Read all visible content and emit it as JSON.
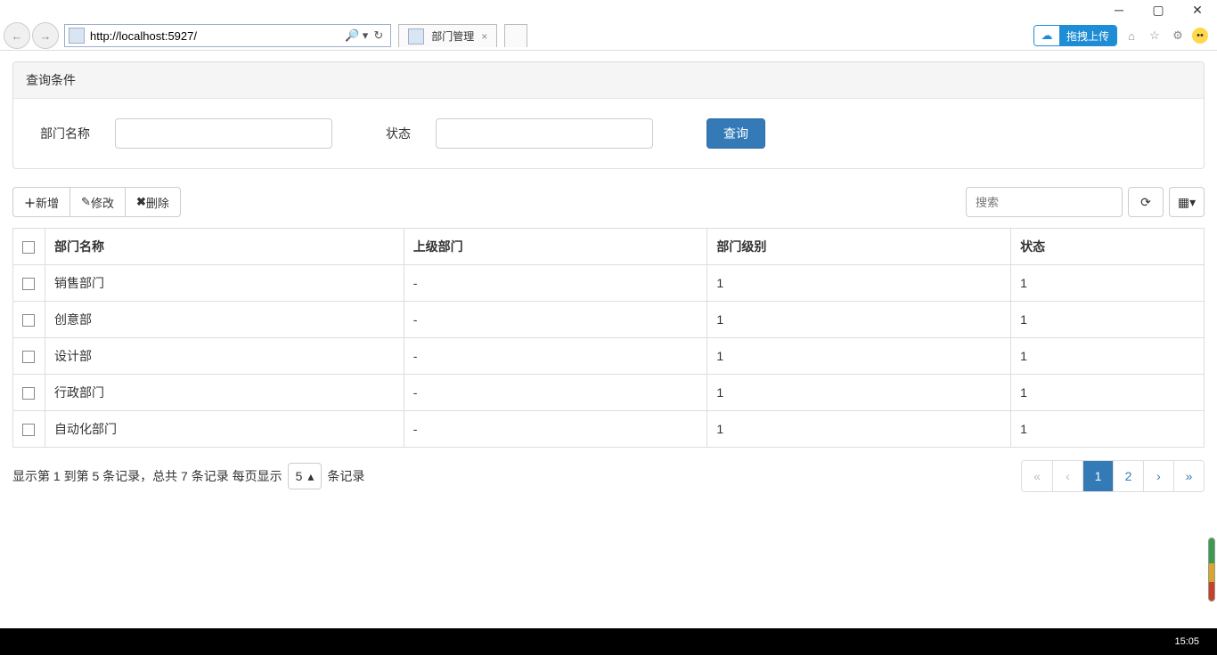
{
  "window": {
    "url": "http://localhost:5927/",
    "tab_title": "部门管理"
  },
  "chrome": {
    "drag_upload": "拖拽上传",
    "taskbar_time": "15:05"
  },
  "query_panel": {
    "title": "查询条件",
    "dept_label": "部门名称",
    "status_label": "状态",
    "search_btn": "查询"
  },
  "toolbar": {
    "add": "新增",
    "edit": "修改",
    "delete": "删除",
    "search_placeholder": "搜索"
  },
  "table": {
    "headers": {
      "name": "部门名称",
      "parent": "上级部门",
      "level": "部门级别",
      "status": "状态"
    },
    "rows": [
      {
        "name": "销售部门",
        "parent": "-",
        "level": "1",
        "status": "1"
      },
      {
        "name": "创意部",
        "parent": "-",
        "level": "1",
        "status": "1"
      },
      {
        "name": "设计部",
        "parent": "-",
        "level": "1",
        "status": "1"
      },
      {
        "name": "行政部门",
        "parent": "-",
        "level": "1",
        "status": "1"
      },
      {
        "name": "自动化部门",
        "parent": "-",
        "level": "1",
        "status": "1"
      }
    ]
  },
  "footer": {
    "info_prefix": "显示第 1 到第 5 条记录，总共 7 条记录 每页显示",
    "page_size": "5",
    "info_suffix": "条记录",
    "pages": [
      "«",
      "‹",
      "1",
      "2",
      "›",
      "»"
    ],
    "active_page": "1"
  }
}
